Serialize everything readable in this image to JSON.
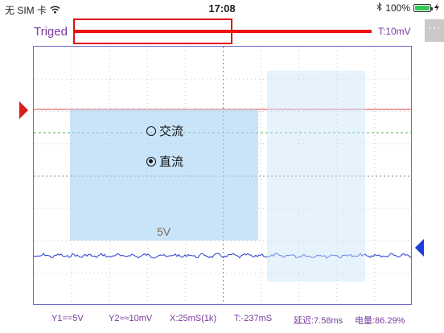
{
  "statusbar": {
    "carrier": "无 SIM 卡",
    "time": "17:08",
    "battery_text": "100%",
    "battery_level": 1.0,
    "icons": [
      "wifi-icon",
      "bluetooth-icon",
      "battery-icon",
      "charging-icon"
    ]
  },
  "trigger": {
    "status": "Triged",
    "level": "T:10mV"
  },
  "menu": {
    "more_label": "···",
    "options": [
      {
        "label": "交流",
        "selected": false
      },
      {
        "label": "直流",
        "selected": true
      }
    ],
    "voltage_label": "5V"
  },
  "readouts": {
    "y1": "Y1==5V",
    "y2": "Y2≈≈10mV",
    "x": "X:25mS(1k)",
    "t": "T:-237mS",
    "delay": "延迟:7.58ms",
    "battery": "电量:86.29%"
  },
  "colors": {
    "ch1": "#e34a4a",
    "ch2": "#2a3bcf",
    "trigger": "#ee1111",
    "text": "#7a3aa0"
  }
}
